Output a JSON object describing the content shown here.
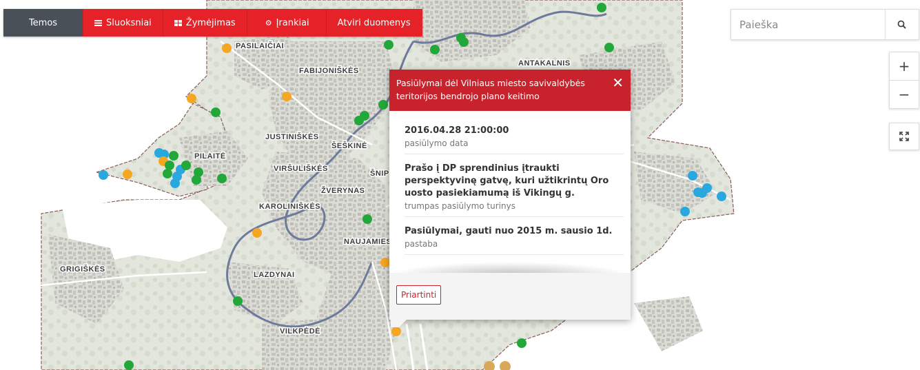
{
  "nav": {
    "temos": "Temos",
    "sluoksniai": "Sluoksniai",
    "zymejimas": "Žymėjimas",
    "irankiai": "Įrankiai",
    "atviri": "Atviri duomenys"
  },
  "search": {
    "placeholder": "Paieška"
  },
  "zoom": {
    "in": "+",
    "out": "−"
  },
  "popup": {
    "title": "Pasiūlymai dėl Vilniaus miesto savivaldybės teritorijos bendrojo plano keitimo",
    "fields": [
      {
        "value": "2016.04.28 21:00:00",
        "label": "pasiūlymo data"
      },
      {
        "value": "Prašo į DP sprendinius įtraukti perspektyvinę gatvę, kuri užtikrintų Oro uosto pasiekiamumą iš Vikingų g.",
        "label": "trumpas pasiūlymo turinys"
      },
      {
        "value": "Pasiūlymai, gauti nuo 2015 m. sausio 1d.",
        "label": "pastaba"
      }
    ],
    "zoom_button": "Priartinti"
  },
  "map_labels": [
    "PASILAIČIAI",
    "FABIJONIŠKĖS",
    "ANTAKALNIS",
    "JUSTINIŠKĖS",
    "ŠEŠKINĖ",
    "PILAITĖ",
    "VIRŠULIŠKĖS",
    "ŠNIP",
    "ŽVERYNAS",
    "KAROLINIŠKĖS",
    "NAUJAMIES",
    "GRIGIŠKĖS",
    "LAZDYNAI",
    "VILKPĖDĖ"
  ],
  "colors": {
    "green": "#22a83a",
    "orange": "#f5a623",
    "blue": "#29a8e0",
    "tan": "#d9a95b",
    "brand_red": "#e52227"
  }
}
